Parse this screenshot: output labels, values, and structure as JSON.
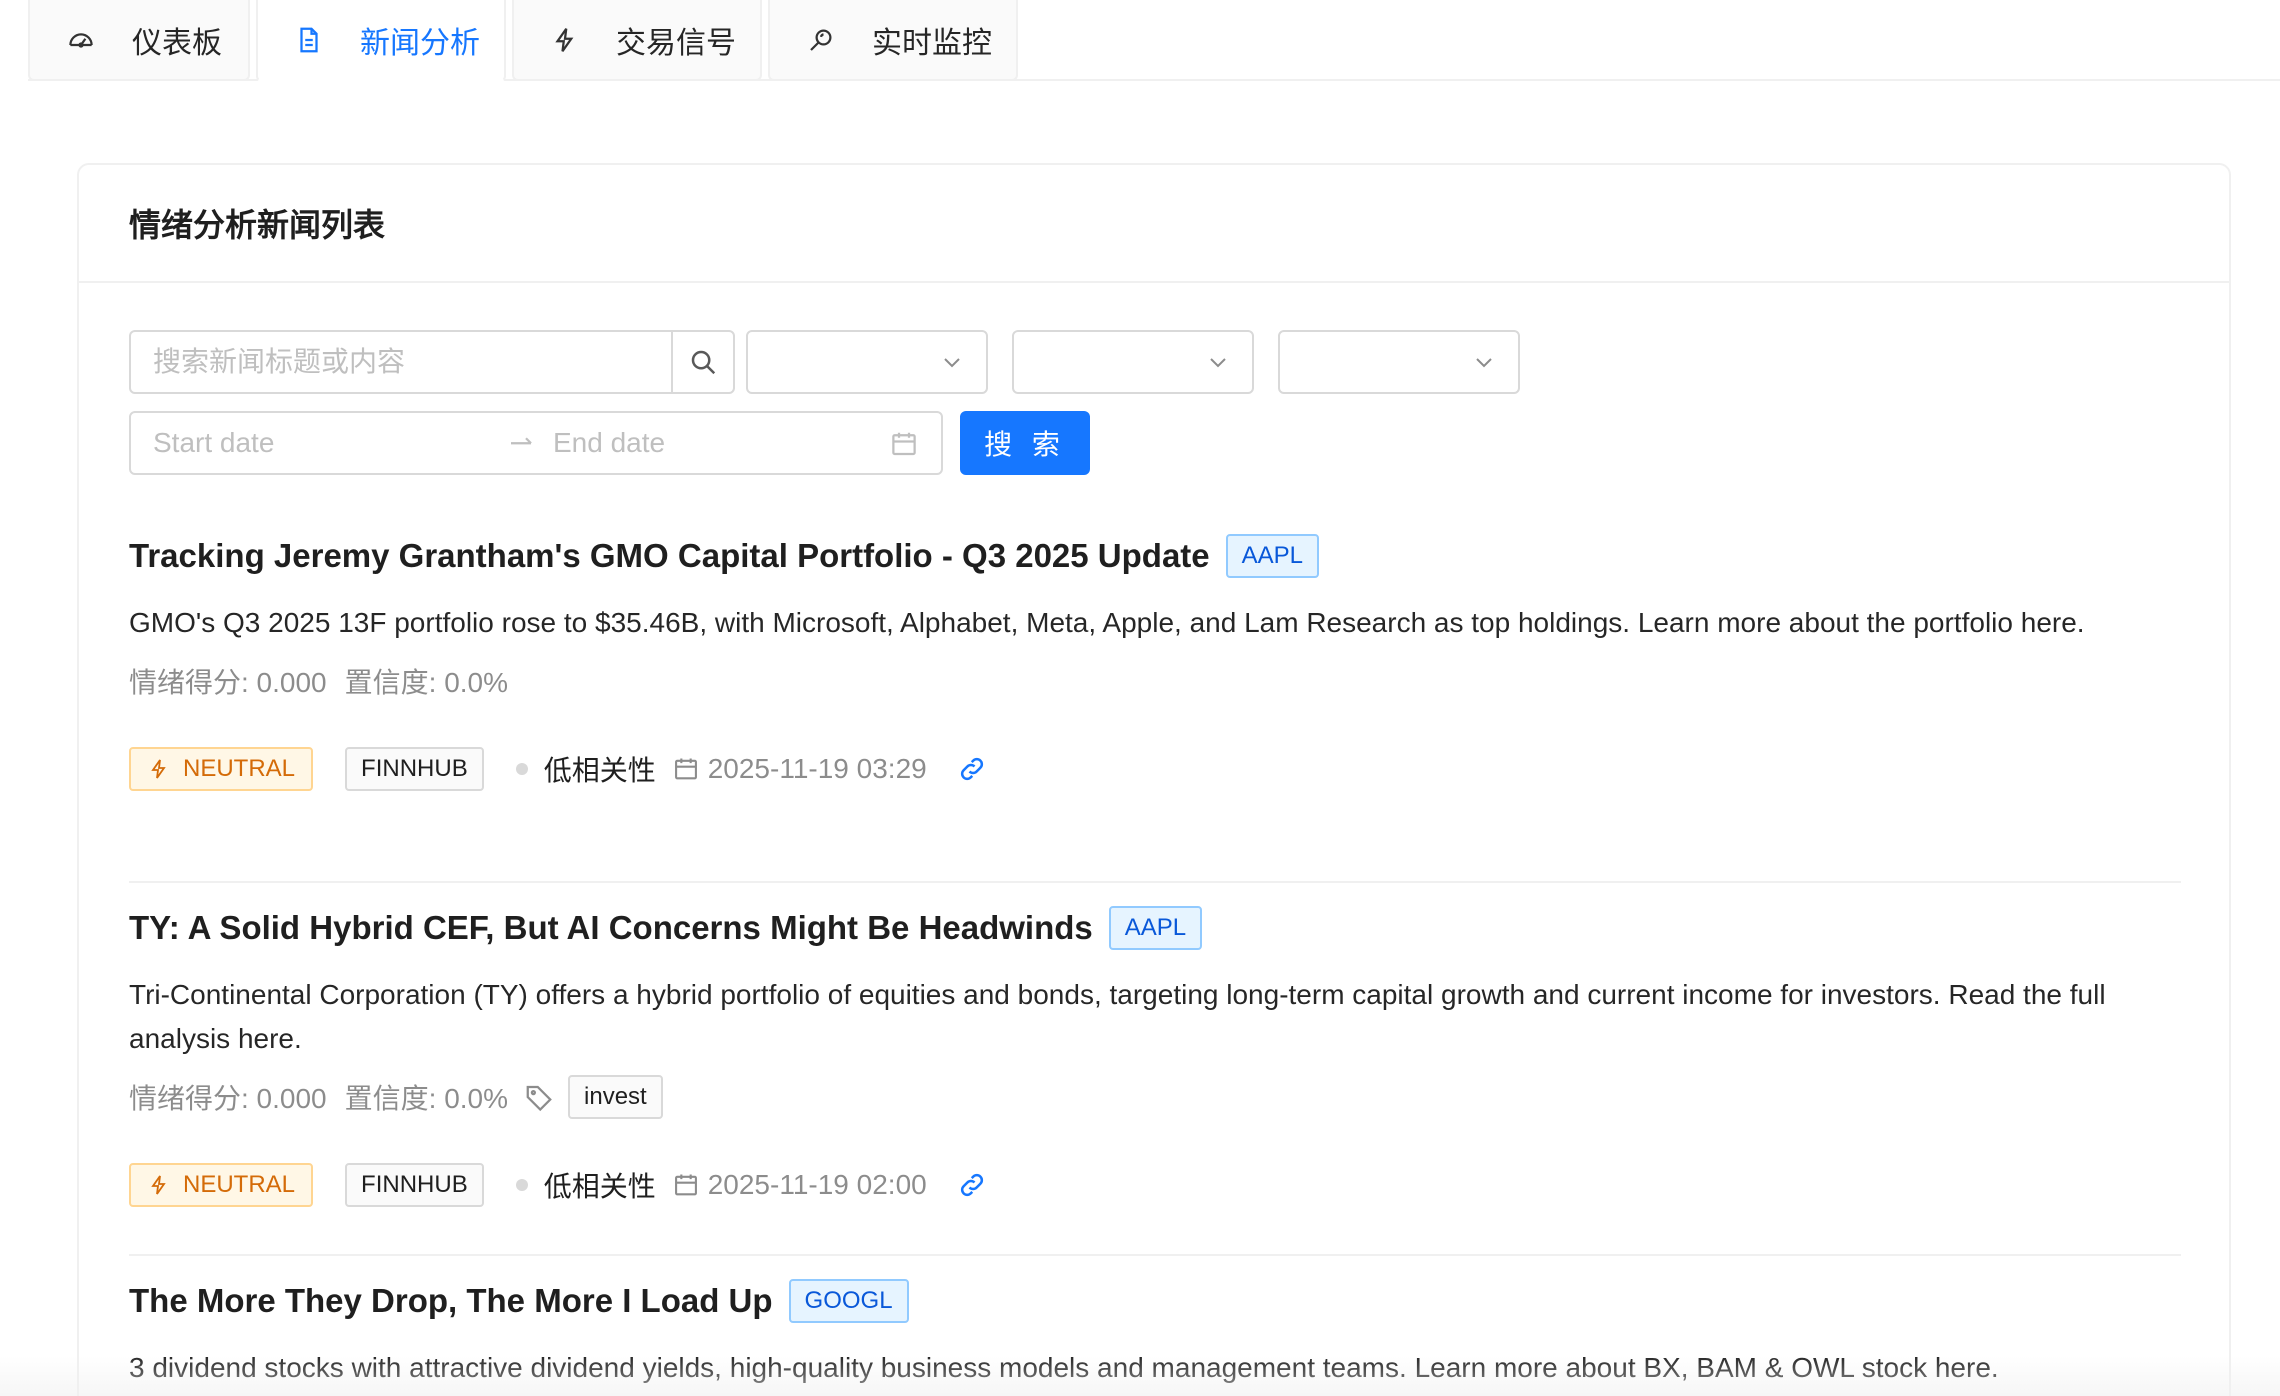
{
  "tabs": [
    {
      "label": "仪表板",
      "icon": "dashboard-icon"
    },
    {
      "label": "新闻分析",
      "icon": "file-text-icon"
    },
    {
      "label": "交易信号",
      "icon": "thunderbolt-icon"
    },
    {
      "label": "实时监控",
      "icon": "monitor-search-icon"
    }
  ],
  "active_tab": "新闻分析",
  "card": {
    "title": "情绪分析新闻列表"
  },
  "filters": {
    "search_placeholder": "搜索新闻标题或内容",
    "start_placeholder": "Start date",
    "end_placeholder": "End date",
    "search_button": "搜 索"
  },
  "news": [
    {
      "title": "Tracking Jeremy Grantham's GMO Capital Portfolio - Q3 2025 Update",
      "ticker": "AAPL",
      "description": "GMO's Q3 2025 13F portfolio rose to $35.46B, with Microsoft, Alphabet, Meta, Apple, and Lam Research as top holdings. Learn more about the portfolio here.",
      "score": "情绪得分: 0.000",
      "confidence": "置信度: 0.0%",
      "sentiment": "NEUTRAL",
      "source": "FINNHUB",
      "relevance": "低相关性",
      "date": "2025-11-19 03:29"
    },
    {
      "title": "TY: A Solid Hybrid CEF, But AI Concerns Might Be Headwinds",
      "ticker": "AAPL",
      "description": "Tri-Continental Corporation (TY) offers a hybrid portfolio of equities and bonds, targeting long-term capital growth and current income for investors. Read the full analysis here.",
      "score": "情绪得分: 0.000",
      "confidence": "置信度: 0.0%",
      "keyword": "invest",
      "sentiment": "NEUTRAL",
      "source": "FINNHUB",
      "relevance": "低相关性",
      "date": "2025-11-19 02:00"
    },
    {
      "title": "The More They Drop, The More I Load Up",
      "ticker": "GOOGL",
      "description": "3 dividend stocks with attractive dividend yields, high-quality business models and management teams. Learn more about BX, BAM & OWL stock here."
    }
  ],
  "colors": {
    "primary": "#1677ff",
    "neutral_tag": "#d46b08",
    "ticker_tag": "#0958d9"
  }
}
